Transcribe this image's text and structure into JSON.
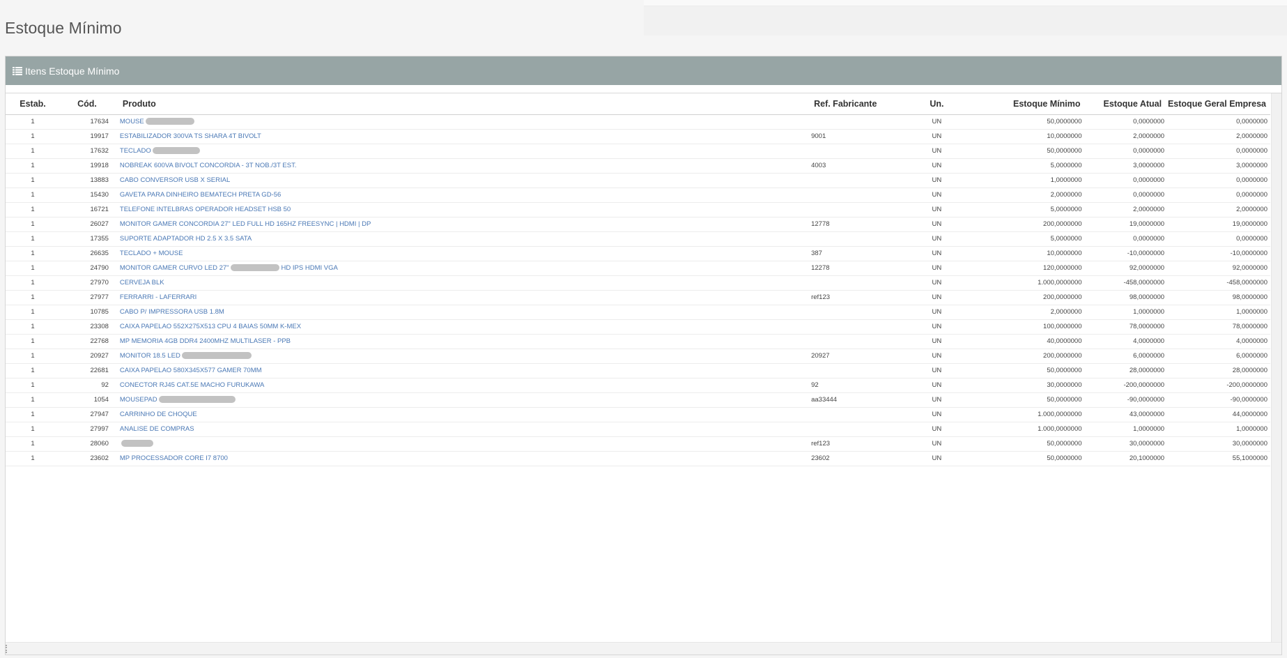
{
  "page": {
    "title": "Estoque Mínimo"
  },
  "panel": {
    "heading": "Itens Estoque Mínimo"
  },
  "columns": {
    "estab": "Estab.",
    "cod": "Cód.",
    "produto": "Produto",
    "ref": "Ref. Fabricante",
    "un": "Un.",
    "minimo": "Estoque Mínimo",
    "atual": "Estoque Atual",
    "geral": "Estoque Geral Empresa"
  },
  "rows": [
    {
      "estab": "1",
      "cod": "17634",
      "produto": "MOUSE",
      "ref": "",
      "un": "UN",
      "minimo": "50,0000000",
      "atual": "0,0000000",
      "geral": "0,0000000"
    },
    {
      "estab": "1",
      "cod": "19917",
      "produto": "ESTABILIZADOR 300VA TS SHARA 4T BIVOLT",
      "ref": "9001",
      "un": "UN",
      "minimo": "10,0000000",
      "atual": "2,0000000",
      "geral": "2,0000000"
    },
    {
      "estab": "1",
      "cod": "17632",
      "produto": "TECLADO",
      "ref": "",
      "un": "UN",
      "minimo": "50,0000000",
      "atual": "0,0000000",
      "geral": "0,0000000"
    },
    {
      "estab": "1",
      "cod": "19918",
      "produto": "NOBREAK 600VA BIVOLT CONCORDIA - 3T NOB./3T EST.",
      "ref": "4003",
      "un": "UN",
      "minimo": "5,0000000",
      "atual": "3,0000000",
      "geral": "3,0000000"
    },
    {
      "estab": "1",
      "cod": "13883",
      "produto": "CABO CONVERSOR USB X SERIAL",
      "ref": "",
      "un": "UN",
      "minimo": "1,0000000",
      "atual": "0,0000000",
      "geral": "0,0000000"
    },
    {
      "estab": "1",
      "cod": "15430",
      "produto": "GAVETA PARA DINHEIRO BEMATECH PRETA GD-56",
      "ref": "",
      "un": "UN",
      "minimo": "2,0000000",
      "atual": "0,0000000",
      "geral": "0,0000000"
    },
    {
      "estab": "1",
      "cod": "16721",
      "produto": "TELEFONE INTELBRAS OPERADOR HEADSET HSB 50",
      "ref": "",
      "un": "UN",
      "minimo": "5,0000000",
      "atual": "2,0000000",
      "geral": "2,0000000"
    },
    {
      "estab": "1",
      "cod": "26027",
      "produto": "MONITOR GAMER CONCORDIA 27\" LED FULL HD 165HZ FREESYNC | HDMI | DP",
      "ref": "12778",
      "un": "UN",
      "minimo": "200,0000000",
      "atual": "19,0000000",
      "geral": "19,0000000"
    },
    {
      "estab": "1",
      "cod": "17355",
      "produto": "SUPORTE ADAPTADOR HD 2.5 X 3.5 SATA",
      "ref": "",
      "un": "UN",
      "minimo": "5,0000000",
      "atual": "0,0000000",
      "geral": "0,0000000"
    },
    {
      "estab": "1",
      "cod": "26635",
      "produto": "TECLADO + MOUSE",
      "ref": "387",
      "un": "UN",
      "minimo": "10,0000000",
      "atual": "-10,0000000",
      "geral": "-10,0000000"
    },
    {
      "estab": "1",
      "cod": "24790",
      "produto": "MONITOR GAMER CURVO LED 27\"",
      "produto_suffix": "HD IPS HDMI VGA",
      "ref": "12278",
      "un": "UN",
      "minimo": "120,0000000",
      "atual": "92,0000000",
      "geral": "92,0000000"
    },
    {
      "estab": "1",
      "cod": "27970",
      "produto": "CERVEJA BLK",
      "ref": "",
      "un": "UN",
      "minimo": "1.000,0000000",
      "atual": "-458,0000000",
      "geral": "-458,0000000"
    },
    {
      "estab": "1",
      "cod": "27977",
      "produto": "FERRARRI - LAFERRARI",
      "ref": "ref123",
      "un": "UN",
      "minimo": "200,0000000",
      "atual": "98,0000000",
      "geral": "98,0000000"
    },
    {
      "estab": "1",
      "cod": "10785",
      "produto": "CABO P/ IMPRESSORA USB 1.8M",
      "ref": "",
      "un": "UN",
      "minimo": "2,0000000",
      "atual": "1,0000000",
      "geral": "1,0000000"
    },
    {
      "estab": "1",
      "cod": "23308",
      "produto": "CAIXA PAPELAO 552X275X513 CPU 4 BAIAS 50MM K-MEX",
      "ref": "",
      "un": "UN",
      "minimo": "100,0000000",
      "atual": "78,0000000",
      "geral": "78,0000000"
    },
    {
      "estab": "1",
      "cod": "22768",
      "produto": "MP MEMORIA 4GB DDR4 2400MHZ MULTILASER - PPB",
      "ref": "",
      "un": "UN",
      "minimo": "40,0000000",
      "atual": "4,0000000",
      "geral": "4,0000000"
    },
    {
      "estab": "1",
      "cod": "20927",
      "produto": "MONITOR 18.5 LED",
      "ref": "20927",
      "un": "UN",
      "minimo": "200,0000000",
      "atual": "6,0000000",
      "geral": "6,0000000"
    },
    {
      "estab": "1",
      "cod": "22681",
      "produto": "CAIXA PAPELAO 580X345X577 GAMER 70MM",
      "ref": "",
      "un": "UN",
      "minimo": "50,0000000",
      "atual": "28,0000000",
      "geral": "28,0000000"
    },
    {
      "estab": "1",
      "cod": "92",
      "produto": "CONECTOR RJ45 CAT.5E MACHO FURUKAWA",
      "ref": "92",
      "un": "UN",
      "minimo": "30,0000000",
      "atual": "-200,0000000",
      "geral": "-200,0000000"
    },
    {
      "estab": "1",
      "cod": "1054",
      "produto": "MOUSEPAD",
      "ref": "aa33444",
      "un": "UN",
      "minimo": "50,0000000",
      "atual": "-90,0000000",
      "geral": "-90,0000000"
    },
    {
      "estab": "1",
      "cod": "27947",
      "produto": "CARRINHO DE CHOQUE",
      "ref": "",
      "un": "UN",
      "minimo": "1.000,0000000",
      "atual": "43,0000000",
      "geral": "44,0000000"
    },
    {
      "estab": "1",
      "cod": "27997",
      "produto": "ANALISE DE COMPRAS",
      "ref": "",
      "un": "UN",
      "minimo": "1.000,0000000",
      "atual": "1,0000000",
      "geral": "1,0000000"
    },
    {
      "estab": "1",
      "cod": "28060",
      "produto": "",
      "ref": "ref123",
      "un": "UN",
      "minimo": "50,0000000",
      "atual": "30,0000000",
      "geral": "30,0000000"
    },
    {
      "estab": "1",
      "cod": "23602",
      "produto": "MP PROCESSADOR CORE I7 8700",
      "ref": "23602",
      "un": "UN",
      "minimo": "50,0000000",
      "atual": "20,1000000",
      "geral": "55,1000000"
    }
  ]
}
